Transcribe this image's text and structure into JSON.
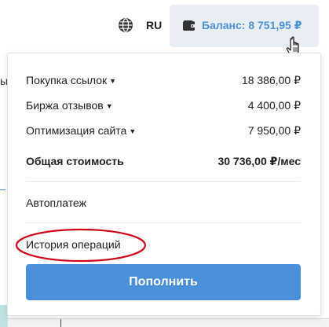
{
  "header": {
    "language": "RU",
    "balance_label": "Баланс: 8 751,95 ₽"
  },
  "icons": {
    "globe": "globe-icon",
    "wallet": "wallet-icon",
    "cursor": "hand-pointer-icon"
  },
  "colors": {
    "accent": "#4a90d9",
    "balance_bg": "#e9eef5",
    "highlight": "#d0021b"
  },
  "dropdown": {
    "items": [
      {
        "label": "Покупка ссылок",
        "value": "18 386,00 ₽"
      },
      {
        "label": "Биржа отзывов",
        "value": "4 400,00 ₽"
      },
      {
        "label": "Оптимизация сайта",
        "value": "7 950,00 ₽"
      }
    ],
    "total": {
      "label": "Общая стоимость",
      "value": "30 736,00 ₽/мес"
    },
    "autopay": "Автоплатеж",
    "history": "История операций",
    "topup_button": "Пополнить"
  }
}
